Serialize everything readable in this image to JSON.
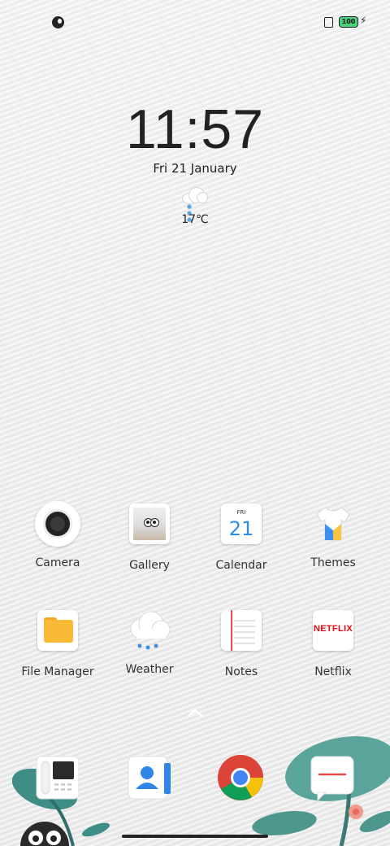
{
  "status_bar": {
    "battery": "100",
    "icons": [
      "notification-icon",
      "sim-icon",
      "battery-icon",
      "charging-icon"
    ]
  },
  "lock_widget": {
    "time": "11:57",
    "date": "Fri 21 January",
    "weather_icon": "snow-cloud-icon",
    "temperature": "17℃"
  },
  "apps": [
    {
      "label": "Camera",
      "icon": "camera-icon"
    },
    {
      "label": "Gallery",
      "icon": "gallery-icon"
    },
    {
      "label": "Calendar",
      "icon": "calendar-icon",
      "day": "FRI",
      "date": "21"
    },
    {
      "label": "Themes",
      "icon": "themes-icon"
    },
    {
      "label": "File Manager",
      "icon": "folder-icon"
    },
    {
      "label": "Weather",
      "icon": "weather-icon"
    },
    {
      "label": "Notes",
      "icon": "notes-icon"
    },
    {
      "label": "Netflix",
      "icon": "netflix-icon",
      "logo_text": "NETFLIX"
    }
  ],
  "dock": [
    {
      "name": "phone",
      "icon": "phone-icon"
    },
    {
      "name": "contacts",
      "icon": "contacts-icon"
    },
    {
      "name": "chrome",
      "icon": "chrome-icon"
    },
    {
      "name": "messages",
      "icon": "messages-icon"
    }
  ],
  "colors": {
    "accent_blue": "#2e8ce6",
    "netflix_red": "#e50914",
    "folder_yellow": "#f8b934",
    "battery_green": "#4bd17a"
  }
}
